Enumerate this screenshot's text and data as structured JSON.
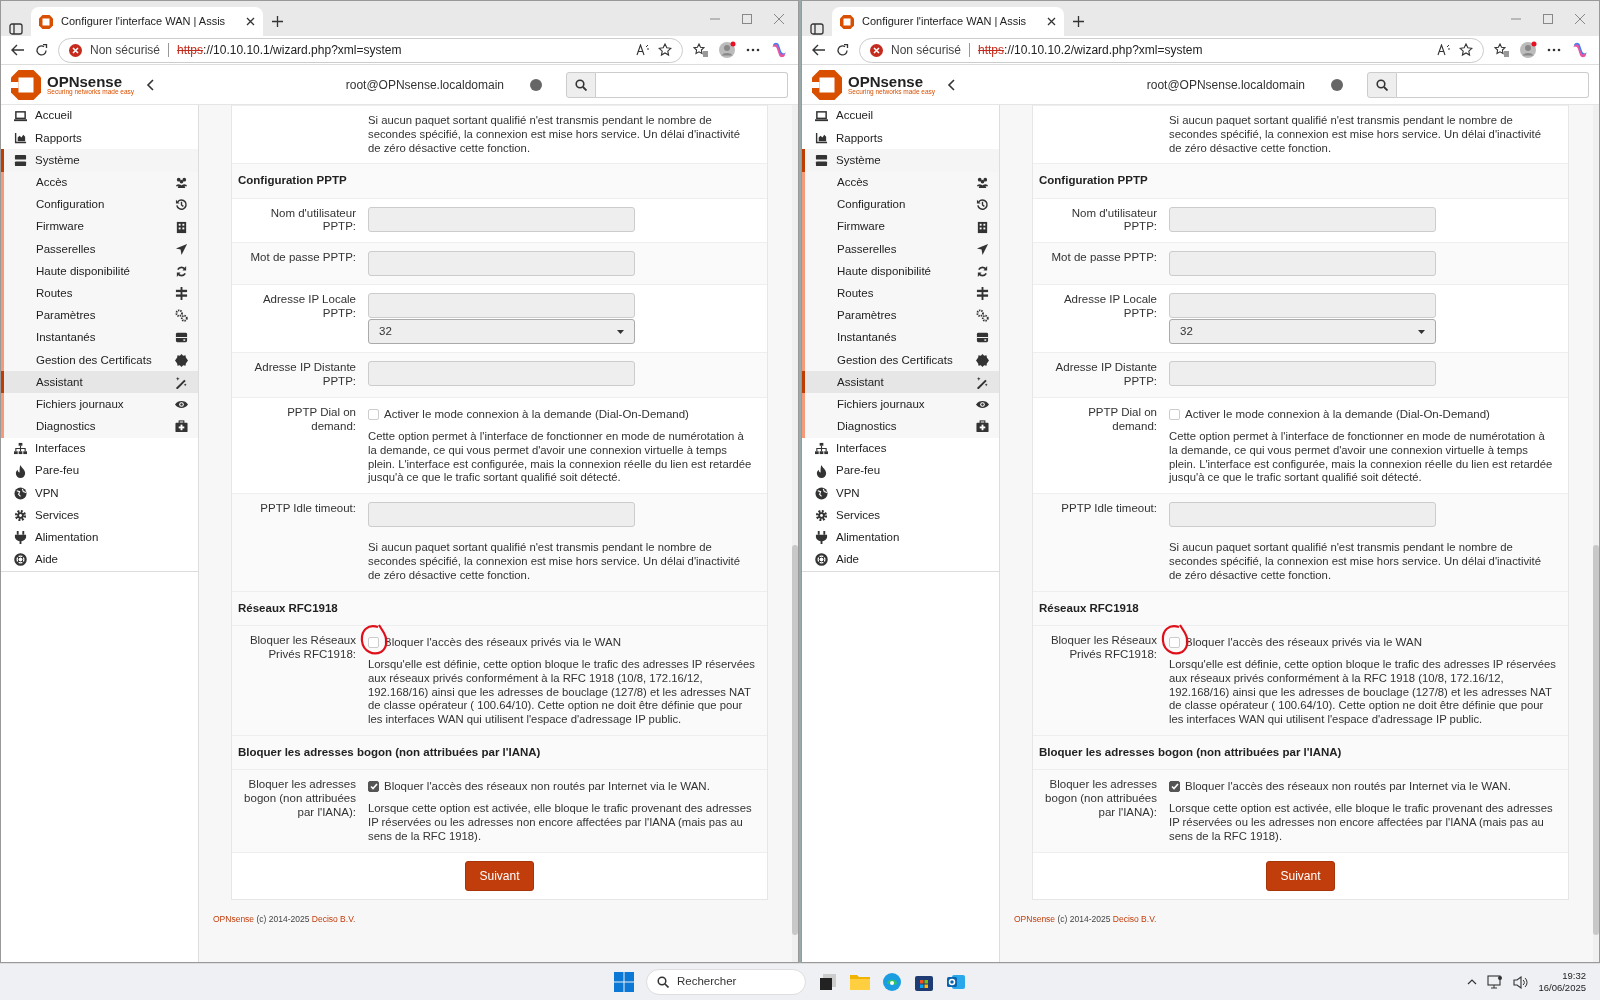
{
  "windows": [
    {
      "tab": {
        "title": "Configurer l'interface WAN | Assis"
      },
      "address": {
        "security": "Non sécurisé",
        "scheme": "https",
        "rest": "://10.10.10.1/wizard.php?xml=system"
      },
      "logo": {
        "name": "OPNsense",
        "tagline": "Securing networks made easy"
      },
      "user": "root@OPNsense.localdomain",
      "sidebar": [
        {
          "label": "Accueil",
          "expanded": false
        },
        {
          "label": "Rapports",
          "expanded": false
        },
        {
          "label": "Système",
          "expanded": true,
          "children": [
            {
              "label": "Accès",
              "selected": false
            },
            {
              "label": "Configuration",
              "selected": false
            },
            {
              "label": "Firmware",
              "selected": false
            },
            {
              "label": "Passerelles",
              "selected": false
            },
            {
              "label": "Haute disponibilité",
              "selected": false
            },
            {
              "label": "Routes",
              "selected": false
            },
            {
              "label": "Paramètres",
              "selected": false
            },
            {
              "label": "Instantanés",
              "selected": false
            },
            {
              "label": "Gestion des Certificats",
              "selected": false
            },
            {
              "label": "Assistant",
              "selected": true
            },
            {
              "label": "Fichiers journaux",
              "selected": false
            },
            {
              "label": "Diagnostics",
              "selected": false
            }
          ]
        },
        {
          "label": "Interfaces",
          "expanded": false
        },
        {
          "label": "Pare-feu",
          "expanded": false
        },
        {
          "label": "VPN",
          "expanded": false
        },
        {
          "label": "Services",
          "expanded": false
        },
        {
          "label": "Alimentation",
          "expanded": false
        },
        {
          "label": "Aide",
          "expanded": false
        }
      ],
      "form": [
        {
          "kind": "note",
          "help": "Si aucun paquet sortant qualifié n'est transmis pendant le nombre de secondes spécifié, la connexion est mise hors service. Un délai d'inactivité de zéro désactive cette fonction."
        },
        {
          "kind": "heading",
          "text": "Configuration PPTP"
        },
        {
          "kind": "input",
          "label": "Nom d'utilisateur PPTP:"
        },
        {
          "kind": "input",
          "label": "Mot de passe PPTP:"
        },
        {
          "kind": "input-select",
          "label": "Adresse IP Locale PPTP:",
          "select_value": "32"
        },
        {
          "kind": "input",
          "label": "Adresse IP Distante PPTP:"
        },
        {
          "kind": "checkbox",
          "label": "PPTP Dial on demand:",
          "checkbox_label": "Activer le mode connexion à la demande (Dial-On-Demand)",
          "checked": false,
          "circled": false,
          "help": "Cette option permet à l'interface de fonctionner en mode de numérotation à la demande, ce qui vous permet d'avoir une connexion virtuelle à temps plein. L'interface est configurée, mais la connexion réelle du lien est retardée jusqu'à ce que le trafic sortant qualifié soit détecté."
        },
        {
          "kind": "input",
          "label": "PPTP Idle timeout:",
          "help": "Si aucun paquet sortant qualifié n'est transmis pendant le nombre de secondes spécifié, la connexion est mise hors service. Un délai d'inactivité de zéro désactive cette fonction."
        },
        {
          "kind": "heading",
          "text": "Réseaux RFC1918"
        },
        {
          "kind": "checkbox",
          "label": "Bloquer les Réseaux Privés RFC1918:",
          "checkbox_label": "Bloquer l'accès des réseaux privés via le WAN",
          "checked": false,
          "circled": true,
          "help": "Lorsqu'elle est définie, cette option bloque le trafic des adresses IP réservées aux réseaux privés conformément à la RFC 1918 (10/8, 172.16/12, 192.168/16) ainsi que les adresses de bouclage (127/8) et les adresses NAT de classe opérateur ( 100.64/10). Cette option ne doit être définie que pour les interfaces WAN qui utilisent l'espace d'adressage IP public."
        },
        {
          "kind": "heading",
          "text": "Bloquer les adresses bogon (non attribuées par l'IANA)"
        },
        {
          "kind": "checkbox",
          "label": "Bloquer les adresses bogon (non attribuées par l'IANA):",
          "checkbox_label": "Bloquer l'accès des réseaux non routés par Internet via le WAN.",
          "checked": true,
          "circled": false,
          "help": "Lorsque cette option est activée, elle bloque le trafic provenant des adresses IP réservées ou les adresses non encore affectées par l'IANA (mais pas au sens de la RFC 1918)."
        },
        {
          "kind": "button",
          "text": "Suivant"
        }
      ],
      "footer": {
        "brand": "OPNsense",
        "text": "(c) 2014-2025",
        "company": "Deciso B.V."
      }
    },
    {
      "tab": {
        "title": "Configurer l'interface WAN | Assis"
      },
      "address": {
        "security": "Non sécurisé",
        "scheme": "https",
        "rest": "://10.10.10.2/wizard.php?xml=system"
      },
      "logo": {
        "name": "OPNsense",
        "tagline": "Securing networks made easy"
      },
      "user": "root@OPNsense.localdomain",
      "sidebar": [
        {
          "label": "Accueil",
          "expanded": false
        },
        {
          "label": "Rapports",
          "expanded": false
        },
        {
          "label": "Système",
          "expanded": true,
          "children": [
            {
              "label": "Accès",
              "selected": false
            },
            {
              "label": "Configuration",
              "selected": false
            },
            {
              "label": "Firmware",
              "selected": false
            },
            {
              "label": "Passerelles",
              "selected": false
            },
            {
              "label": "Haute disponibilité",
              "selected": false
            },
            {
              "label": "Routes",
              "selected": false
            },
            {
              "label": "Paramètres",
              "selected": false
            },
            {
              "label": "Instantanés",
              "selected": false
            },
            {
              "label": "Gestion des Certificats",
              "selected": false
            },
            {
              "label": "Assistant",
              "selected": true
            },
            {
              "label": "Fichiers journaux",
              "selected": false
            },
            {
              "label": "Diagnostics",
              "selected": false
            }
          ]
        },
        {
          "label": "Interfaces",
          "expanded": false
        },
        {
          "label": "Pare-feu",
          "expanded": false
        },
        {
          "label": "VPN",
          "expanded": false
        },
        {
          "label": "Services",
          "expanded": false
        },
        {
          "label": "Alimentation",
          "expanded": false
        },
        {
          "label": "Aide",
          "expanded": false
        }
      ],
      "form": [
        {
          "kind": "note",
          "help": "Si aucun paquet sortant qualifié n'est transmis pendant le nombre de secondes spécifié, la connexion est mise hors service. Un délai d'inactivité de zéro désactive cette fonction."
        },
        {
          "kind": "heading",
          "text": "Configuration PPTP"
        },
        {
          "kind": "input",
          "label": "Nom d'utilisateur PPTP:"
        },
        {
          "kind": "input",
          "label": "Mot de passe PPTP:"
        },
        {
          "kind": "input-select",
          "label": "Adresse IP Locale PPTP:",
          "select_value": "32"
        },
        {
          "kind": "input",
          "label": "Adresse IP Distante PPTP:"
        },
        {
          "kind": "checkbox",
          "label": "PPTP Dial on demand:",
          "checkbox_label": "Activer le mode connexion à la demande (Dial-On-Demand)",
          "checked": false,
          "circled": false,
          "help": "Cette option permet à l'interface de fonctionner en mode de numérotation à la demande, ce qui vous permet d'avoir une connexion virtuelle à temps plein. L'interface est configurée, mais la connexion réelle du lien est retardée jusqu'à ce que le trafic sortant qualifié soit détecté."
        },
        {
          "kind": "input",
          "label": "PPTP Idle timeout:",
          "help": "Si aucun paquet sortant qualifié n'est transmis pendant le nombre de secondes spécifié, la connexion est mise hors service. Un délai d'inactivité de zéro désactive cette fonction."
        },
        {
          "kind": "heading",
          "text": "Réseaux RFC1918"
        },
        {
          "kind": "checkbox",
          "label": "Bloquer les Réseaux Privés RFC1918:",
          "checkbox_label": "Bloquer l'accès des réseaux privés via le WAN",
          "checked": false,
          "circled": true,
          "help": "Lorsqu'elle est définie, cette option bloque le trafic des adresses IP réservées aux réseaux privés conformément à la RFC 1918 (10/8, 172.16/12, 192.168/16) ainsi que les adresses de bouclage (127/8) et les adresses NAT de classe opérateur ( 100.64/10). Cette option ne doit être définie que pour les interfaces WAN qui utilisent l'espace d'adressage IP public."
        },
        {
          "kind": "heading",
          "text": "Bloquer les adresses bogon (non attribuées par l'IANA)"
        },
        {
          "kind": "checkbox",
          "label": "Bloquer les adresses bogon (non attribuées par l'IANA):",
          "checkbox_label": "Bloquer l'accès des réseaux non routés par Internet via le WAN.",
          "checked": true,
          "circled": false,
          "help": "Lorsque cette option est activée, elle bloque le trafic provenant des adresses IP réservées ou les adresses non encore affectées par l'IANA (mais pas au sens de la RFC 1918)."
        },
        {
          "kind": "button",
          "text": "Suivant"
        }
      ],
      "footer": {
        "brand": "OPNsense",
        "text": "(c) 2014-2025",
        "company": "Deciso B.V."
      }
    }
  ],
  "taskbar": {
    "search_placeholder": "Rechercher",
    "time": "19:32",
    "date": "16/06/2025"
  }
}
